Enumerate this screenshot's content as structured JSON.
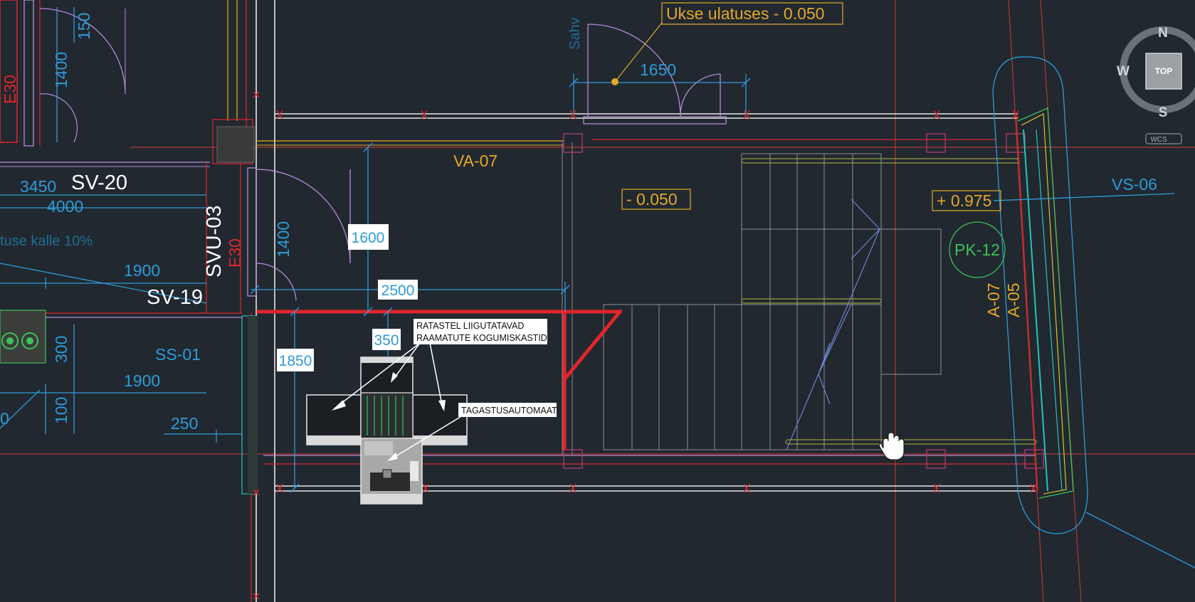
{
  "colors": {
    "background": "#212830",
    "dim_blue": "#2f9bd6",
    "wall_white": "#e8e8e8",
    "red_line": "#e0262b",
    "grid_red": "#c0392b",
    "yellow_tag": "#e3a92a",
    "door_purple": "#b98ad8",
    "green": "#3cc25a",
    "cyan": "#27c4b8"
  },
  "viewcube": {
    "north": "N",
    "south": "S",
    "west": "W",
    "face": "TOP",
    "ucs": "WCS"
  },
  "labels": {
    "door_level": "Ukse ulatuses - 0.050",
    "room_va07": "VA-07",
    "level_minus": "- 0.050",
    "level_plus": "+ 0.975",
    "pk12": "PK-12",
    "vs06": "VS-06",
    "a07": "A-07",
    "a05": "A-05",
    "sv20": "SV-20",
    "sv19": "SV-19",
    "svu03": "SVU-03",
    "e30_left": "E30",
    "e30_mid": "E30",
    "ss01": "SS-01",
    "slope_note": "tuse kalle 10%",
    "sahv": "Sahv",
    "bins_line1": "RATASTEL LIIGUTATAVAD",
    "bins_line2": "RAAMATUTE KOGUMISKASTID",
    "machine": "TAGASTUSAUTOMAAT"
  },
  "dimensions": {
    "d150": "150",
    "d1400_left": "1400",
    "d1400_mid": "1400",
    "d1650": "1650",
    "d3450": "3450",
    "d4000": "4000",
    "d1900_top": "1900",
    "d1900_bottom": "1900",
    "d1600": "1600",
    "d2500": "2500",
    "d350": "350",
    "d1850": "1850",
    "d300": "300",
    "d100": "100",
    "d250": "250",
    "d0": "0"
  }
}
